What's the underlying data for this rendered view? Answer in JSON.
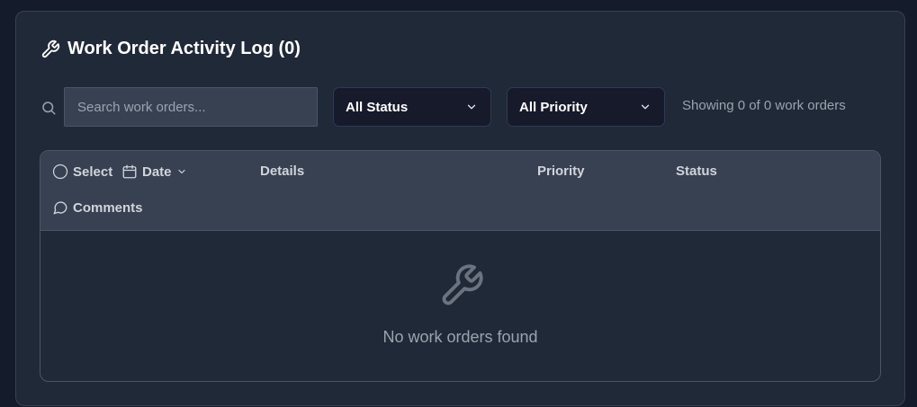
{
  "header": {
    "title": "Work Order Activity Log (0)",
    "icon": "wrench-icon"
  },
  "filters": {
    "search_placeholder": "Search work orders...",
    "search_value": "",
    "status_selected": "All Status",
    "priority_selected": "All Priority",
    "showing_text": "Showing 0 of 0 work orders"
  },
  "table": {
    "columns": {
      "select": "Select",
      "date": "Date",
      "details": "Details",
      "priority": "Priority",
      "status": "Status",
      "comments": "Comments"
    },
    "rows": [],
    "empty_text": "No work orders found"
  },
  "colors": {
    "background": "#141b2a",
    "panel": "#1f2937",
    "header_row": "#374151",
    "select_bg": "#161a2b",
    "muted_text": "#9ca3af"
  }
}
